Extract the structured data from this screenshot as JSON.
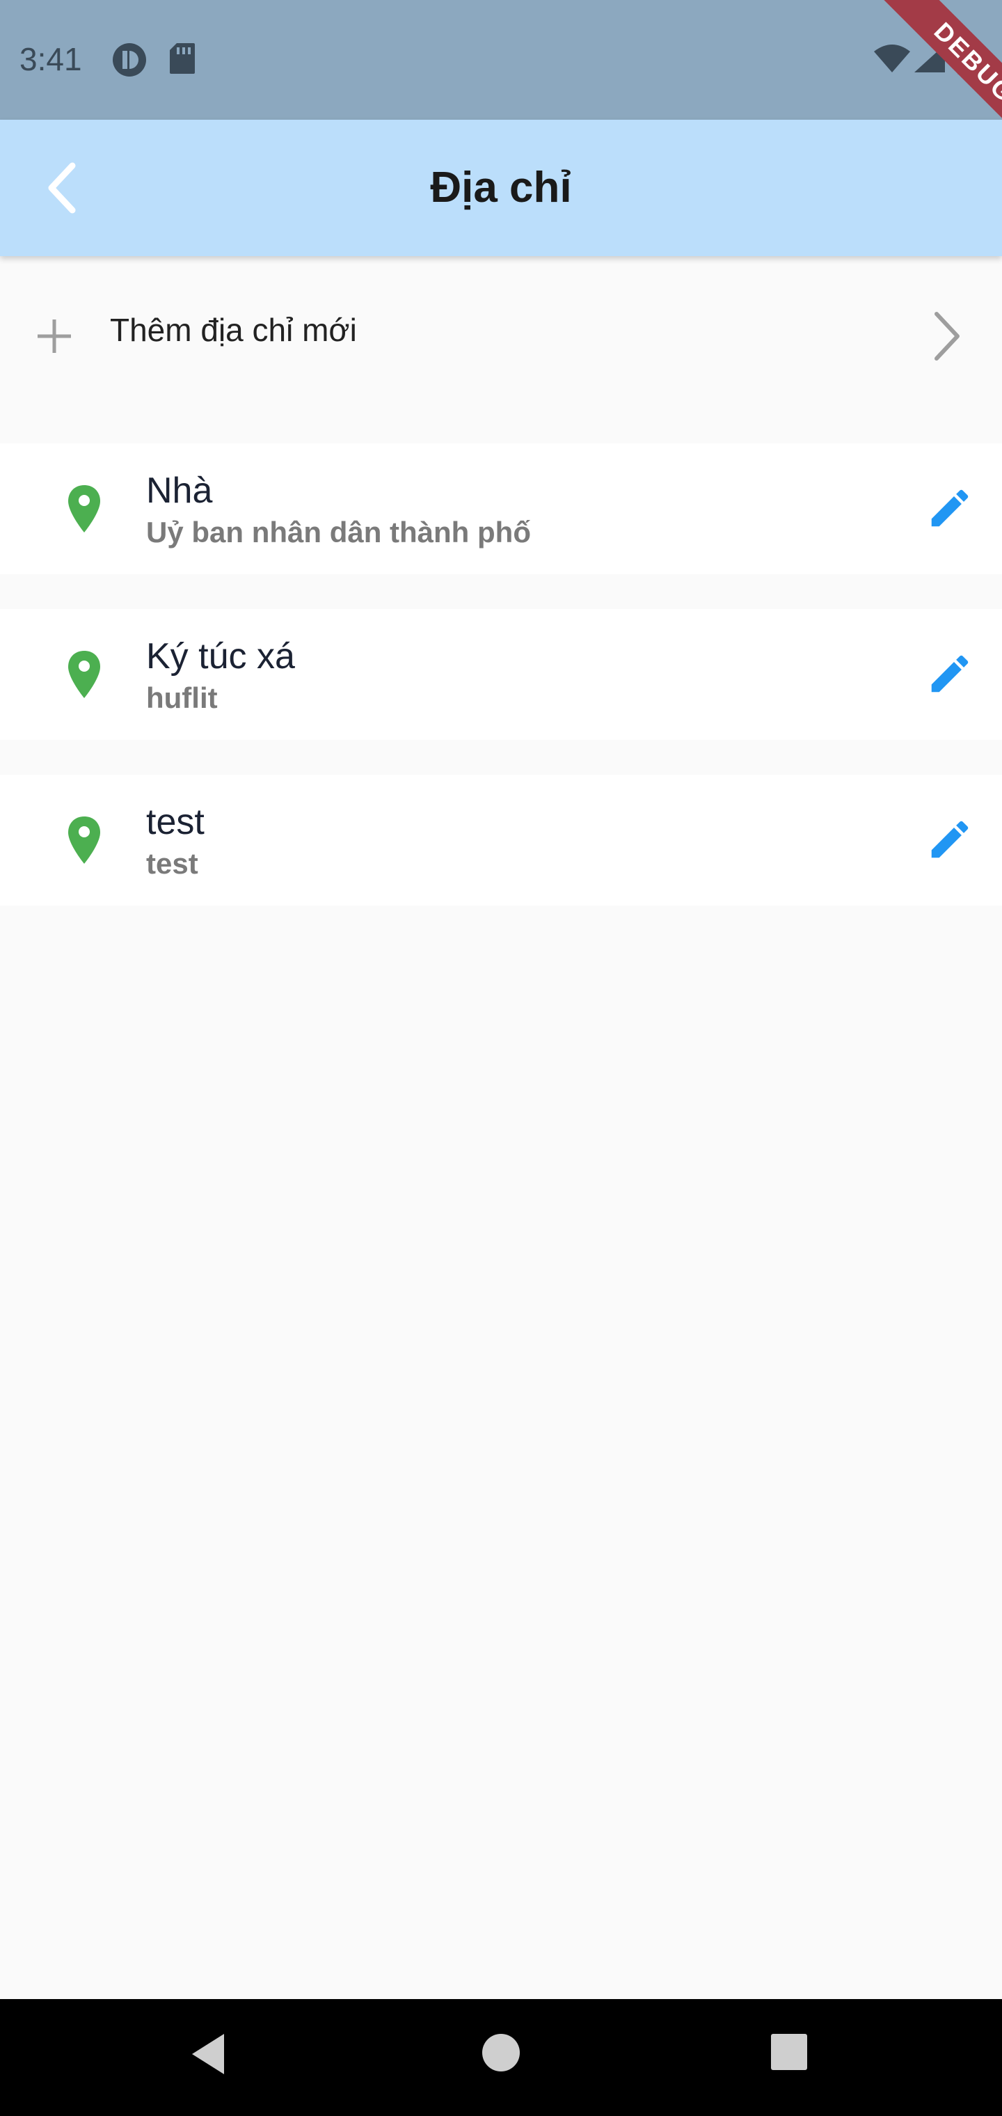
{
  "status_bar": {
    "time": "3:41",
    "icons": [
      "circle-status-icon",
      "sd-card-icon",
      "wifi-icon",
      "signal-icon",
      "battery-icon"
    ]
  },
  "debug_banner": {
    "label": "DEBUG"
  },
  "app_bar": {
    "title": "Địa chỉ",
    "back_icon": "chevron-left-icon"
  },
  "add_address": {
    "label": "Thêm địa chỉ mới",
    "icon": "plus-icon",
    "trailing_icon": "chevron-right-icon"
  },
  "addresses": [
    {
      "name": "Nhà",
      "detail": "Uỷ ban nhân dân thành phố"
    },
    {
      "name": "Ký túc xá",
      "detail": "huflit"
    },
    {
      "name": "test",
      "detail": "test"
    }
  ],
  "nav_bar": {
    "icons": [
      "back-triangle-icon",
      "home-circle-icon",
      "recents-square-icon"
    ]
  },
  "colors": {
    "status_bar": "#8ca8bf",
    "app_bar": "#bbdefb",
    "pin": "#4caf50",
    "edit": "#2196f3",
    "background": "#fafafa"
  }
}
